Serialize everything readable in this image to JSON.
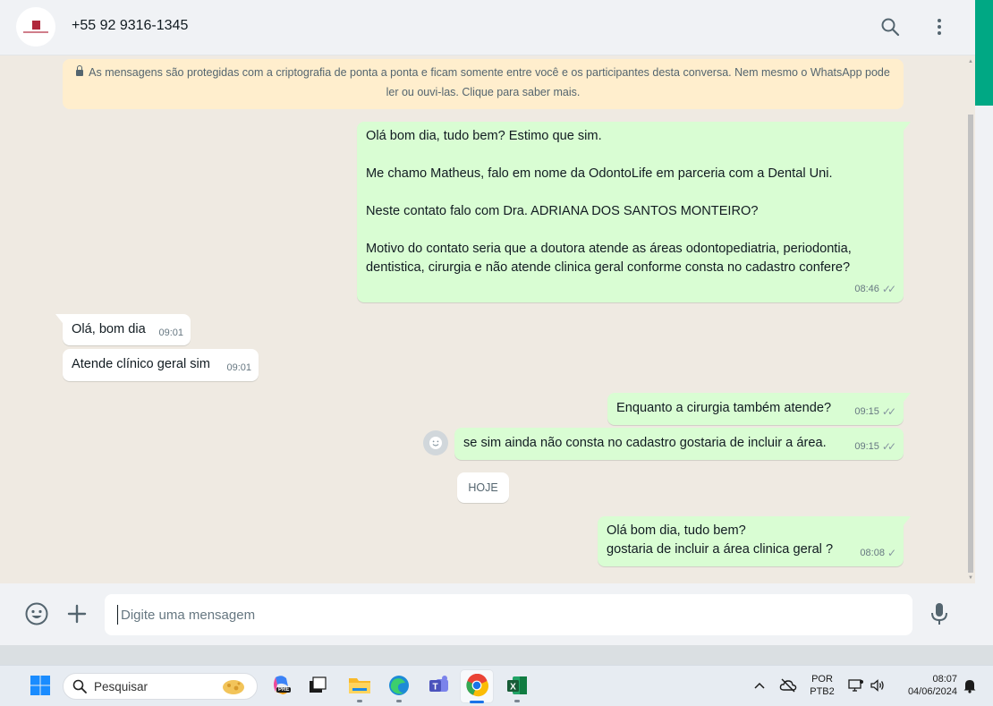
{
  "header": {
    "contact_name": "+55 92 9316-1345",
    "icons": [
      "search-icon",
      "kebab-menu-icon"
    ]
  },
  "banner": {
    "text": "As mensagens são protegidas com a criptografia de ponta a ponta e ficam somente entre você e os participantes desta conversa. Nem mesmo o WhatsApp pode ler ou ouvi-las. Clique para saber mais."
  },
  "messages": [
    {
      "direction": "out",
      "lines": [
        "Olá bom dia, tudo bem? Estimo que sim.",
        "",
        "Me chamo Matheus, falo em nome da OdontoLife em parceria com a Dental Uni.",
        "",
        "Neste contato falo com Dra. ADRIANA DOS SANTOS MONTEIRO?",
        "",
        "Motivo do contato seria que a doutora atende as áreas odontopediatria, periodontia, dentistica, cirurgia e não atende clinica geral conforme consta no cadastro confere?"
      ],
      "time": "08:46",
      "status": "read"
    },
    {
      "direction": "in",
      "text": "Olá, bom dia",
      "time": "09:01"
    },
    {
      "direction": "in",
      "text": "Atende clínico geral sim",
      "time": "09:01"
    },
    {
      "direction": "out",
      "text": "Enquanto a cirurgia também atende?",
      "time": "09:15",
      "status": "read"
    },
    {
      "direction": "out",
      "text": "se sim ainda não consta no cadastro gostaria de incluir a área.",
      "time": "09:15",
      "status": "read"
    },
    {
      "direction": "out",
      "lines": [
        "Olá bom dia, tudo bem?",
        "gostaria de incluir a área clinica geral ?"
      ],
      "time": "08:08",
      "status": "sent"
    }
  ],
  "day_divider": "HOJE",
  "composer": {
    "placeholder": "Digite uma mensagem",
    "icons": [
      "emoji-icon",
      "plus-icon",
      "microphone-icon"
    ]
  },
  "taskbar": {
    "search_label": "Pesquisar",
    "language_line1": "POR",
    "language_line2": "PTB2",
    "time": "08:07",
    "date": "04/06/2024",
    "copilot_badge": "PRE"
  },
  "colors": {
    "outgoing_bubble": "#d9fdd3",
    "incoming_bubble": "#ffffff",
    "chat_background": "#efeae2",
    "banner_background": "#ffeecd",
    "accent": "#00a884"
  }
}
